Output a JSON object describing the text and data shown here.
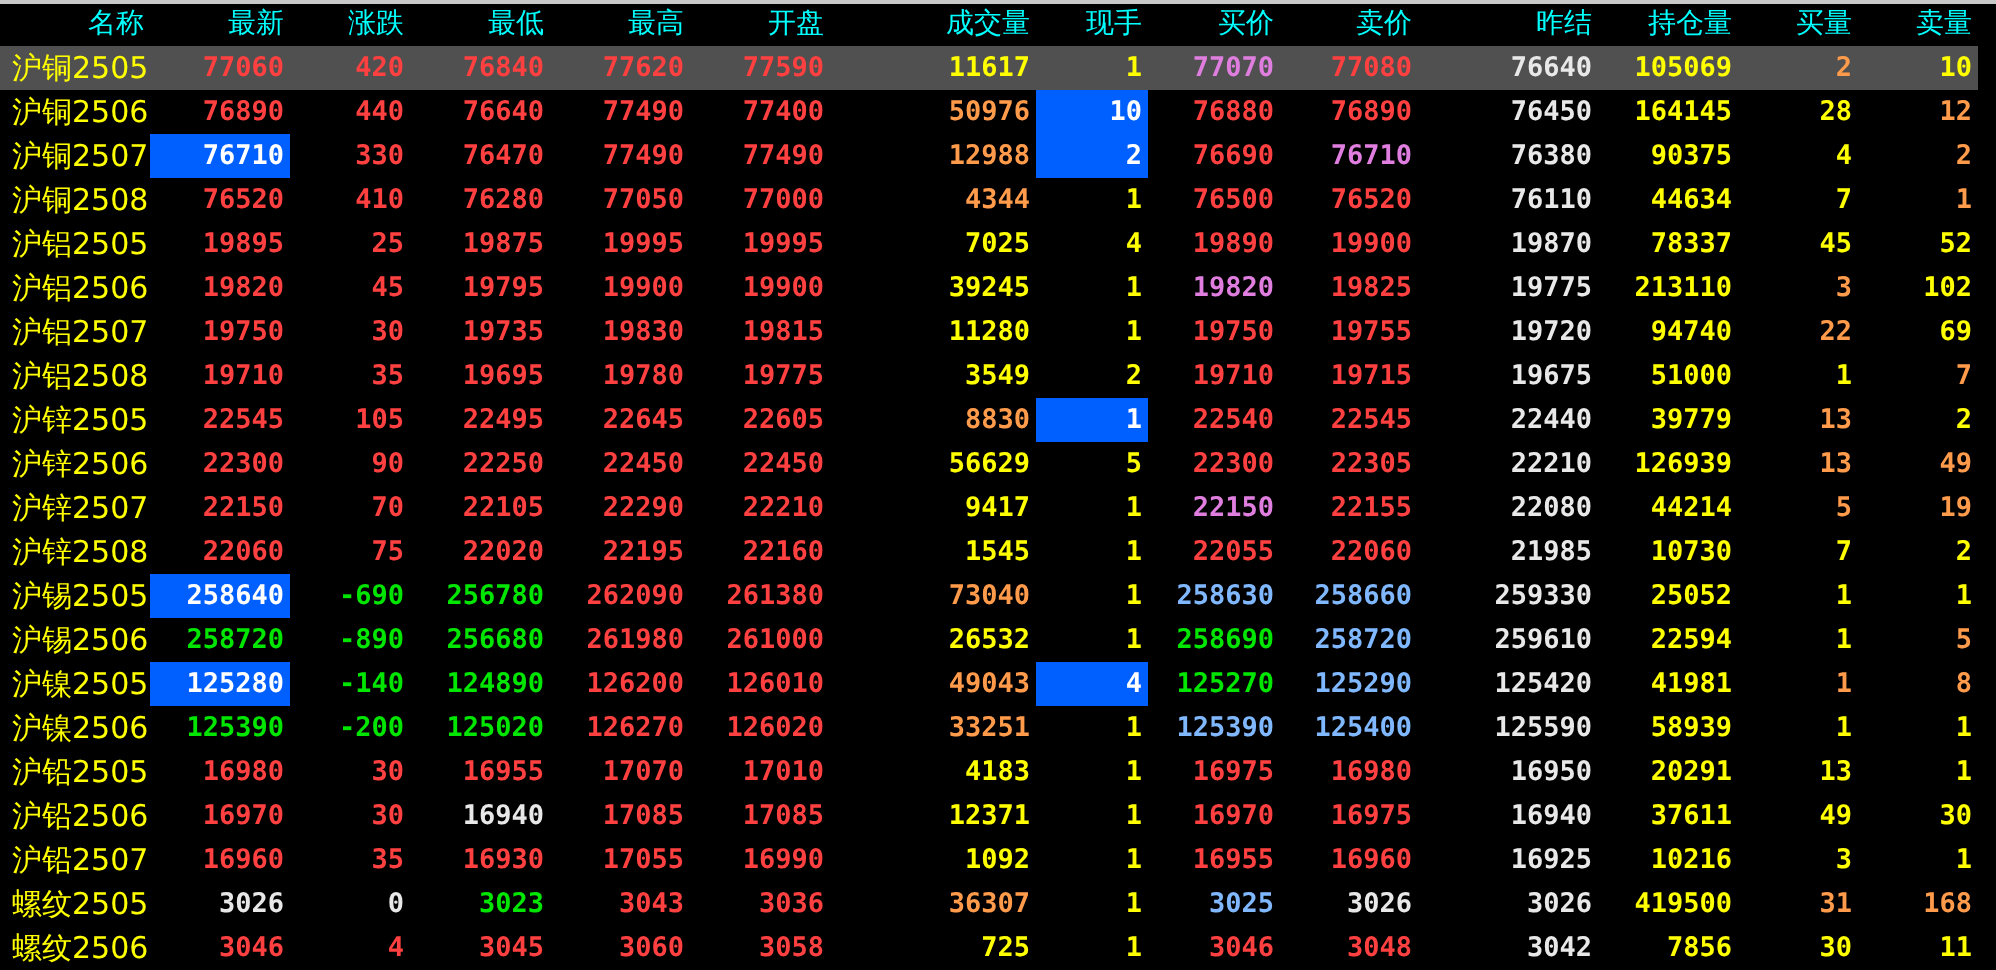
{
  "table": {
    "columns": [
      "名称",
      "最新",
      "涨跌",
      "最低",
      "最高",
      "开盘",
      "成交量",
      "现手",
      "买价",
      "卖价",
      "昨结",
      "持仓量",
      "买量",
      "卖量"
    ],
    "rows": [
      {
        "selected": true,
        "cells": [
          {
            "text": "沪铜2505"
          },
          {
            "text": "77060",
            "color": "#ff4040"
          },
          {
            "text": "420",
            "color": "#ff4040"
          },
          {
            "text": "76840",
            "color": "#ff4040"
          },
          {
            "text": "77620",
            "color": "#ff4040"
          },
          {
            "text": "77590",
            "color": "#ff4040"
          },
          {
            "text": "11617",
            "color": "#ffff00"
          },
          {
            "text": "1",
            "color": "#ffff00"
          },
          {
            "text": "77070",
            "color": "#e07ee0"
          },
          {
            "text": "77080",
            "color": "#ff4040"
          },
          {
            "text": "76640",
            "color": "#e8e8e8"
          },
          {
            "text": "105069",
            "color": "#ffff00"
          },
          {
            "text": "2",
            "color": "#ff9b4a"
          },
          {
            "text": "10",
            "color": "#ffff00"
          }
        ]
      },
      {
        "selected": false,
        "cells": [
          {
            "text": "沪铜2506"
          },
          {
            "text": "76890",
            "color": "#ff4040"
          },
          {
            "text": "440",
            "color": "#ff4040"
          },
          {
            "text": "76640",
            "color": "#ff4040"
          },
          {
            "text": "77490",
            "color": "#ff4040"
          },
          {
            "text": "77400",
            "color": "#ff4040"
          },
          {
            "text": "50976",
            "color": "#ff9b4a"
          },
          {
            "text": "10",
            "color": "#ffffff",
            "highlighted": true
          },
          {
            "text": "76880",
            "color": "#ff4040"
          },
          {
            "text": "76890",
            "color": "#ff4040"
          },
          {
            "text": "76450",
            "color": "#e8e8e8"
          },
          {
            "text": "164145",
            "color": "#ffff00"
          },
          {
            "text": "28",
            "color": "#ffff00"
          },
          {
            "text": "12",
            "color": "#ff9b4a"
          }
        ]
      },
      {
        "selected": false,
        "cells": [
          {
            "text": "沪铜2507"
          },
          {
            "text": "76710",
            "color": "#ffffff",
            "highlighted": true
          },
          {
            "text": "330",
            "color": "#ff4040"
          },
          {
            "text": "76470",
            "color": "#ff4040"
          },
          {
            "text": "77490",
            "color": "#ff4040"
          },
          {
            "text": "77490",
            "color": "#ff4040"
          },
          {
            "text": "12988",
            "color": "#ff9b4a"
          },
          {
            "text": "2",
            "color": "#ffffff",
            "highlighted": true
          },
          {
            "text": "76690",
            "color": "#ff4040"
          },
          {
            "text": "76710",
            "color": "#e07ee0"
          },
          {
            "text": "76380",
            "color": "#e8e8e8"
          },
          {
            "text": "90375",
            "color": "#ffff00"
          },
          {
            "text": "4",
            "color": "#ffff00"
          },
          {
            "text": "2",
            "color": "#ff9b4a"
          }
        ]
      },
      {
        "selected": false,
        "cells": [
          {
            "text": "沪铜2508"
          },
          {
            "text": "76520",
            "color": "#ff4040"
          },
          {
            "text": "410",
            "color": "#ff4040"
          },
          {
            "text": "76280",
            "color": "#ff4040"
          },
          {
            "text": "77050",
            "color": "#ff4040"
          },
          {
            "text": "77000",
            "color": "#ff4040"
          },
          {
            "text": "4344",
            "color": "#ff9b4a"
          },
          {
            "text": "1",
            "color": "#ffff00"
          },
          {
            "text": "76500",
            "color": "#ff4040"
          },
          {
            "text": "76520",
            "color": "#ff4040"
          },
          {
            "text": "76110",
            "color": "#e8e8e8"
          },
          {
            "text": "44634",
            "color": "#ffff00"
          },
          {
            "text": "7",
            "color": "#ffff00"
          },
          {
            "text": "1",
            "color": "#ff9b4a"
          }
        ]
      },
      {
        "selected": false,
        "cells": [
          {
            "text": "沪铝2505"
          },
          {
            "text": "19895",
            "color": "#ff4040"
          },
          {
            "text": "25",
            "color": "#ff4040"
          },
          {
            "text": "19875",
            "color": "#ff4040"
          },
          {
            "text": "19995",
            "color": "#ff4040"
          },
          {
            "text": "19995",
            "color": "#ff4040"
          },
          {
            "text": "7025",
            "color": "#ffff00"
          },
          {
            "text": "4",
            "color": "#ffff00"
          },
          {
            "text": "19890",
            "color": "#ff4040"
          },
          {
            "text": "19900",
            "color": "#ff4040"
          },
          {
            "text": "19870",
            "color": "#e8e8e8"
          },
          {
            "text": "78337",
            "color": "#ffff00"
          },
          {
            "text": "45",
            "color": "#ffff00"
          },
          {
            "text": "52",
            "color": "#ffff00"
          }
        ]
      },
      {
        "selected": false,
        "cells": [
          {
            "text": "沪铝2506"
          },
          {
            "text": "19820",
            "color": "#ff4040"
          },
          {
            "text": "45",
            "color": "#ff4040"
          },
          {
            "text": "19795",
            "color": "#ff4040"
          },
          {
            "text": "19900",
            "color": "#ff4040"
          },
          {
            "text": "19900",
            "color": "#ff4040"
          },
          {
            "text": "39245",
            "color": "#ffff00"
          },
          {
            "text": "1",
            "color": "#ffff00"
          },
          {
            "text": "19820",
            "color": "#e07ee0"
          },
          {
            "text": "19825",
            "color": "#ff4040"
          },
          {
            "text": "19775",
            "color": "#e8e8e8"
          },
          {
            "text": "213110",
            "color": "#ffff00"
          },
          {
            "text": "3",
            "color": "#ff9b4a"
          },
          {
            "text": "102",
            "color": "#ffff00"
          }
        ]
      },
      {
        "selected": false,
        "cells": [
          {
            "text": "沪铝2507"
          },
          {
            "text": "19750",
            "color": "#ff4040"
          },
          {
            "text": "30",
            "color": "#ff4040"
          },
          {
            "text": "19735",
            "color": "#ff4040"
          },
          {
            "text": "19830",
            "color": "#ff4040"
          },
          {
            "text": "19815",
            "color": "#ff4040"
          },
          {
            "text": "11280",
            "color": "#ffff00"
          },
          {
            "text": "1",
            "color": "#ffff00"
          },
          {
            "text": "19750",
            "color": "#ff4040"
          },
          {
            "text": "19755",
            "color": "#ff4040"
          },
          {
            "text": "19720",
            "color": "#e8e8e8"
          },
          {
            "text": "94740",
            "color": "#ffff00"
          },
          {
            "text": "22",
            "color": "#ff9b4a"
          },
          {
            "text": "69",
            "color": "#ffff00"
          }
        ]
      },
      {
        "selected": false,
        "cells": [
          {
            "text": "沪铝2508"
          },
          {
            "text": "19710",
            "color": "#ff4040"
          },
          {
            "text": "35",
            "color": "#ff4040"
          },
          {
            "text": "19695",
            "color": "#ff4040"
          },
          {
            "text": "19780",
            "color": "#ff4040"
          },
          {
            "text": "19775",
            "color": "#ff4040"
          },
          {
            "text": "3549",
            "color": "#ffff00"
          },
          {
            "text": "2",
            "color": "#ffff00"
          },
          {
            "text": "19710",
            "color": "#ff4040"
          },
          {
            "text": "19715",
            "color": "#ff4040"
          },
          {
            "text": "19675",
            "color": "#e8e8e8"
          },
          {
            "text": "51000",
            "color": "#ffff00"
          },
          {
            "text": "1",
            "color": "#ffff00"
          },
          {
            "text": "7",
            "color": "#ff9b4a"
          }
        ]
      },
      {
        "selected": false,
        "cells": [
          {
            "text": "沪锌2505"
          },
          {
            "text": "22545",
            "color": "#ff4040"
          },
          {
            "text": "105",
            "color": "#ff4040"
          },
          {
            "text": "22495",
            "color": "#ff4040"
          },
          {
            "text": "22645",
            "color": "#ff4040"
          },
          {
            "text": "22605",
            "color": "#ff4040"
          },
          {
            "text": "8830",
            "color": "#ff9b4a"
          },
          {
            "text": "1",
            "color": "#ffffff",
            "highlighted": true
          },
          {
            "text": "22540",
            "color": "#ff4040"
          },
          {
            "text": "22545",
            "color": "#ff4040"
          },
          {
            "text": "22440",
            "color": "#e8e8e8"
          },
          {
            "text": "39779",
            "color": "#ffff00"
          },
          {
            "text": "13",
            "color": "#ff9b4a"
          },
          {
            "text": "2",
            "color": "#ffff00"
          }
        ]
      },
      {
        "selected": false,
        "cells": [
          {
            "text": "沪锌2506"
          },
          {
            "text": "22300",
            "color": "#ff4040"
          },
          {
            "text": "90",
            "color": "#ff4040"
          },
          {
            "text": "22250",
            "color": "#ff4040"
          },
          {
            "text": "22450",
            "color": "#ff4040"
          },
          {
            "text": "22450",
            "color": "#ff4040"
          },
          {
            "text": "56629",
            "color": "#ffff00"
          },
          {
            "text": "5",
            "color": "#ffff00"
          },
          {
            "text": "22300",
            "color": "#ff4040"
          },
          {
            "text": "22305",
            "color": "#ff4040"
          },
          {
            "text": "22210",
            "color": "#e8e8e8"
          },
          {
            "text": "126939",
            "color": "#ffff00"
          },
          {
            "text": "13",
            "color": "#ff9b4a"
          },
          {
            "text": "49",
            "color": "#ff9b4a"
          }
        ]
      },
      {
        "selected": false,
        "cells": [
          {
            "text": "沪锌2507"
          },
          {
            "text": "22150",
            "color": "#ff4040"
          },
          {
            "text": "70",
            "color": "#ff4040"
          },
          {
            "text": "22105",
            "color": "#ff4040"
          },
          {
            "text": "22290",
            "color": "#ff4040"
          },
          {
            "text": "22210",
            "color": "#ff4040"
          },
          {
            "text": "9417",
            "color": "#ffff00"
          },
          {
            "text": "1",
            "color": "#ffff00"
          },
          {
            "text": "22150",
            "color": "#e07ee0"
          },
          {
            "text": "22155",
            "color": "#ff4040"
          },
          {
            "text": "22080",
            "color": "#e8e8e8"
          },
          {
            "text": "44214",
            "color": "#ffff00"
          },
          {
            "text": "5",
            "color": "#ff9b4a"
          },
          {
            "text": "19",
            "color": "#ff9b4a"
          }
        ]
      },
      {
        "selected": false,
        "cells": [
          {
            "text": "沪锌2508"
          },
          {
            "text": "22060",
            "color": "#ff4040"
          },
          {
            "text": "75",
            "color": "#ff4040"
          },
          {
            "text": "22020",
            "color": "#ff4040"
          },
          {
            "text": "22195",
            "color": "#ff4040"
          },
          {
            "text": "22160",
            "color": "#ff4040"
          },
          {
            "text": "1545",
            "color": "#ffff00"
          },
          {
            "text": "1",
            "color": "#ffff00"
          },
          {
            "text": "22055",
            "color": "#ff4040"
          },
          {
            "text": "22060",
            "color": "#ff4040"
          },
          {
            "text": "21985",
            "color": "#e8e8e8"
          },
          {
            "text": "10730",
            "color": "#ffff00"
          },
          {
            "text": "7",
            "color": "#ffff00"
          },
          {
            "text": "2",
            "color": "#ffff00"
          }
        ]
      },
      {
        "selected": false,
        "cells": [
          {
            "text": "沪锡2505"
          },
          {
            "text": "258640",
            "color": "#ffffff",
            "highlighted": true
          },
          {
            "text": "-690",
            "color": "#00e600"
          },
          {
            "text": "256780",
            "color": "#00e600"
          },
          {
            "text": "262090",
            "color": "#ff4040"
          },
          {
            "text": "261380",
            "color": "#ff4040"
          },
          {
            "text": "73040",
            "color": "#ff9b4a"
          },
          {
            "text": "1",
            "color": "#ffff00"
          },
          {
            "text": "258630",
            "color": "#80b8ff"
          },
          {
            "text": "258660",
            "color": "#80b8ff"
          },
          {
            "text": "259330",
            "color": "#e8e8e8"
          },
          {
            "text": "25052",
            "color": "#ffff00"
          },
          {
            "text": "1",
            "color": "#ffff00"
          },
          {
            "text": "1",
            "color": "#ffff00"
          }
        ]
      },
      {
        "selected": false,
        "cells": [
          {
            "text": "沪锡2506"
          },
          {
            "text": "258720",
            "color": "#00e600"
          },
          {
            "text": "-890",
            "color": "#00e600"
          },
          {
            "text": "256680",
            "color": "#00e600"
          },
          {
            "text": "261980",
            "color": "#ff4040"
          },
          {
            "text": "261000",
            "color": "#ff4040"
          },
          {
            "text": "26532",
            "color": "#ffff00"
          },
          {
            "text": "1",
            "color": "#ffff00"
          },
          {
            "text": "258690",
            "color": "#00e600"
          },
          {
            "text": "258720",
            "color": "#80b8ff"
          },
          {
            "text": "259610",
            "color": "#e8e8e8"
          },
          {
            "text": "22594",
            "color": "#ffff00"
          },
          {
            "text": "1",
            "color": "#ffff00"
          },
          {
            "text": "5",
            "color": "#ff9b4a"
          }
        ]
      },
      {
        "selected": false,
        "cells": [
          {
            "text": "沪镍2505"
          },
          {
            "text": "125280",
            "color": "#ffffff",
            "highlighted": true
          },
          {
            "text": "-140",
            "color": "#00e600"
          },
          {
            "text": "124890",
            "color": "#00e600"
          },
          {
            "text": "126200",
            "color": "#ff4040"
          },
          {
            "text": "126010",
            "color": "#ff4040"
          },
          {
            "text": "49043",
            "color": "#ff9b4a"
          },
          {
            "text": "4",
            "color": "#ffffff",
            "highlighted": true
          },
          {
            "text": "125270",
            "color": "#00e600"
          },
          {
            "text": "125290",
            "color": "#80b8ff"
          },
          {
            "text": "125420",
            "color": "#e8e8e8"
          },
          {
            "text": "41981",
            "color": "#ffff00"
          },
          {
            "text": "1",
            "color": "#ff9b4a"
          },
          {
            "text": "8",
            "color": "#ff9b4a"
          }
        ]
      },
      {
        "selected": false,
        "cells": [
          {
            "text": "沪镍2506"
          },
          {
            "text": "125390",
            "color": "#00e600"
          },
          {
            "text": "-200",
            "color": "#00e600"
          },
          {
            "text": "125020",
            "color": "#00e600"
          },
          {
            "text": "126270",
            "color": "#ff4040"
          },
          {
            "text": "126020",
            "color": "#ff4040"
          },
          {
            "text": "33251",
            "color": "#ff9b4a"
          },
          {
            "text": "1",
            "color": "#ffff00"
          },
          {
            "text": "125390",
            "color": "#80b8ff"
          },
          {
            "text": "125400",
            "color": "#80b8ff"
          },
          {
            "text": "125590",
            "color": "#e8e8e8"
          },
          {
            "text": "58939",
            "color": "#ffff00"
          },
          {
            "text": "1",
            "color": "#ffff00"
          },
          {
            "text": "1",
            "color": "#ffff00"
          }
        ]
      },
      {
        "selected": false,
        "cells": [
          {
            "text": "沪铅2505"
          },
          {
            "text": "16980",
            "color": "#ff4040"
          },
          {
            "text": "30",
            "color": "#ff4040"
          },
          {
            "text": "16955",
            "color": "#ff4040"
          },
          {
            "text": "17070",
            "color": "#ff4040"
          },
          {
            "text": "17010",
            "color": "#ff4040"
          },
          {
            "text": "4183",
            "color": "#ffff00"
          },
          {
            "text": "1",
            "color": "#ffff00"
          },
          {
            "text": "16975",
            "color": "#ff4040"
          },
          {
            "text": "16980",
            "color": "#ff4040"
          },
          {
            "text": "16950",
            "color": "#e8e8e8"
          },
          {
            "text": "20291",
            "color": "#ffff00"
          },
          {
            "text": "13",
            "color": "#ffff00"
          },
          {
            "text": "1",
            "color": "#ffff00"
          }
        ]
      },
      {
        "selected": false,
        "cells": [
          {
            "text": "沪铅2506"
          },
          {
            "text": "16970",
            "color": "#ff4040"
          },
          {
            "text": "30",
            "color": "#ff4040"
          },
          {
            "text": "16940",
            "color": "#e8e8e8"
          },
          {
            "text": "17085",
            "color": "#ff4040"
          },
          {
            "text": "17085",
            "color": "#ff4040"
          },
          {
            "text": "12371",
            "color": "#ffff00"
          },
          {
            "text": "1",
            "color": "#ffff00"
          },
          {
            "text": "16970",
            "color": "#ff4040"
          },
          {
            "text": "16975",
            "color": "#ff4040"
          },
          {
            "text": "16940",
            "color": "#e8e8e8"
          },
          {
            "text": "37611",
            "color": "#ffff00"
          },
          {
            "text": "49",
            "color": "#ffff00"
          },
          {
            "text": "30",
            "color": "#ffff00"
          }
        ]
      },
      {
        "selected": false,
        "cells": [
          {
            "text": "沪铅2507"
          },
          {
            "text": "16960",
            "color": "#ff4040"
          },
          {
            "text": "35",
            "color": "#ff4040"
          },
          {
            "text": "16930",
            "color": "#ff4040"
          },
          {
            "text": "17055",
            "color": "#ff4040"
          },
          {
            "text": "16990",
            "color": "#ff4040"
          },
          {
            "text": "1092",
            "color": "#ffff00"
          },
          {
            "text": "1",
            "color": "#ffff00"
          },
          {
            "text": "16955",
            "color": "#ff4040"
          },
          {
            "text": "16960",
            "color": "#ff4040"
          },
          {
            "text": "16925",
            "color": "#e8e8e8"
          },
          {
            "text": "10216",
            "color": "#ffff00"
          },
          {
            "text": "3",
            "color": "#ffff00"
          },
          {
            "text": "1",
            "color": "#ffff00"
          }
        ]
      },
      {
        "selected": false,
        "cells": [
          {
            "text": "螺纹2505"
          },
          {
            "text": "3026",
            "color": "#e8e8e8"
          },
          {
            "text": "0",
            "color": "#e8e8e8"
          },
          {
            "text": "3023",
            "color": "#00e600"
          },
          {
            "text": "3043",
            "color": "#ff4040"
          },
          {
            "text": "3036",
            "color": "#ff4040"
          },
          {
            "text": "36307",
            "color": "#ff9b4a"
          },
          {
            "text": "1",
            "color": "#ffff00"
          },
          {
            "text": "3025",
            "color": "#80b8ff"
          },
          {
            "text": "3026",
            "color": "#e8e8e8"
          },
          {
            "text": "3026",
            "color": "#e8e8e8"
          },
          {
            "text": "419500",
            "color": "#ffff00"
          },
          {
            "text": "31",
            "color": "#ff9b4a"
          },
          {
            "text": "168",
            "color": "#ff9b4a"
          }
        ]
      },
      {
        "selected": false,
        "cells": [
          {
            "text": "螺纹2506"
          },
          {
            "text": "3046",
            "color": "#ff4040"
          },
          {
            "text": "4",
            "color": "#ff4040"
          },
          {
            "text": "3045",
            "color": "#ff4040"
          },
          {
            "text": "3060",
            "color": "#ff4040"
          },
          {
            "text": "3058",
            "color": "#ff4040"
          },
          {
            "text": "725",
            "color": "#ffff00"
          },
          {
            "text": "1",
            "color": "#ffff00"
          },
          {
            "text": "3046",
            "color": "#ff4040"
          },
          {
            "text": "3048",
            "color": "#ff4040"
          },
          {
            "text": "3042",
            "color": "#e8e8e8"
          },
          {
            "text": "7856",
            "color": "#ffff00"
          },
          {
            "text": "30",
            "color": "#ffff00"
          },
          {
            "text": "11",
            "color": "#ffff00"
          }
        ]
      }
    ]
  }
}
